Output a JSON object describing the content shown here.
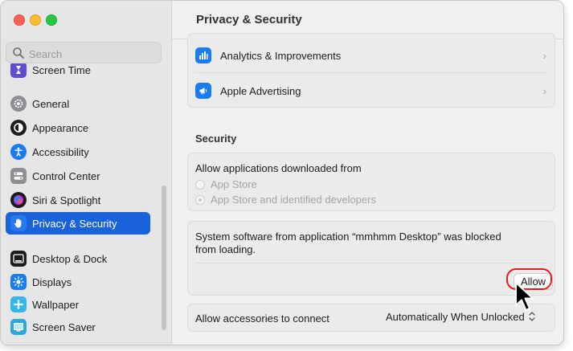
{
  "window": {
    "traffic_lights": {
      "close": "×",
      "minimize": "–",
      "maximize": "+"
    }
  },
  "sidebar": {
    "search": {
      "placeholder": "Search"
    },
    "items": [
      {
        "label": "Screen Time",
        "icon": "hourglass-icon",
        "color": "#5d4fd1"
      },
      {
        "label": "General",
        "icon": "gear-icon",
        "color": "#8e8e93"
      },
      {
        "label": "Appearance",
        "icon": "appearance-icon",
        "color": "#1c1c1e"
      },
      {
        "label": "Accessibility",
        "icon": "accessibility-icon",
        "color": "#1a7cf4"
      },
      {
        "label": "Control Center",
        "icon": "control-center-icon",
        "color": "#8e8e93"
      },
      {
        "label": "Siri & Spotlight",
        "icon": "siri-icon",
        "color": "#b03fd6"
      },
      {
        "label": "Privacy & Security",
        "icon": "hand-icon",
        "color": "#1a62d9",
        "selected": true
      },
      {
        "label": "Desktop & Dock",
        "icon": "dock-icon",
        "color": "#1c1c1e"
      },
      {
        "label": "Displays",
        "icon": "sun-icon",
        "color": "#1a7cf4"
      },
      {
        "label": "Wallpaper",
        "icon": "wallpaper-icon",
        "color": "#35b6e8"
      },
      {
        "label": "Screen Saver",
        "icon": "screen-saver-icon",
        "color": "#2fa7d8"
      }
    ]
  },
  "main": {
    "title": "Privacy & Security",
    "top_card": {
      "rows": [
        {
          "label": "Analytics & Improvements",
          "icon": "bar-chart-icon",
          "color": "#1a7cf4"
        },
        {
          "label": "Apple Advertising",
          "icon": "megaphone-icon",
          "color": "#1a7cf4"
        }
      ]
    },
    "security": {
      "heading": "Security",
      "allow_from_label": "Allow applications downloaded from",
      "option_app_store": "App Store",
      "option_identified": "App Store and identified developers",
      "blocked_message_line1": "System software from application “mmhmm Desktop” was blocked",
      "blocked_message_line2": "from loading.",
      "allow_button": "Allow",
      "accessories_label": "Allow accessories to connect",
      "accessories_value": "Automatically When Unlocked",
      "highlight_color": "#e41b1b"
    }
  }
}
